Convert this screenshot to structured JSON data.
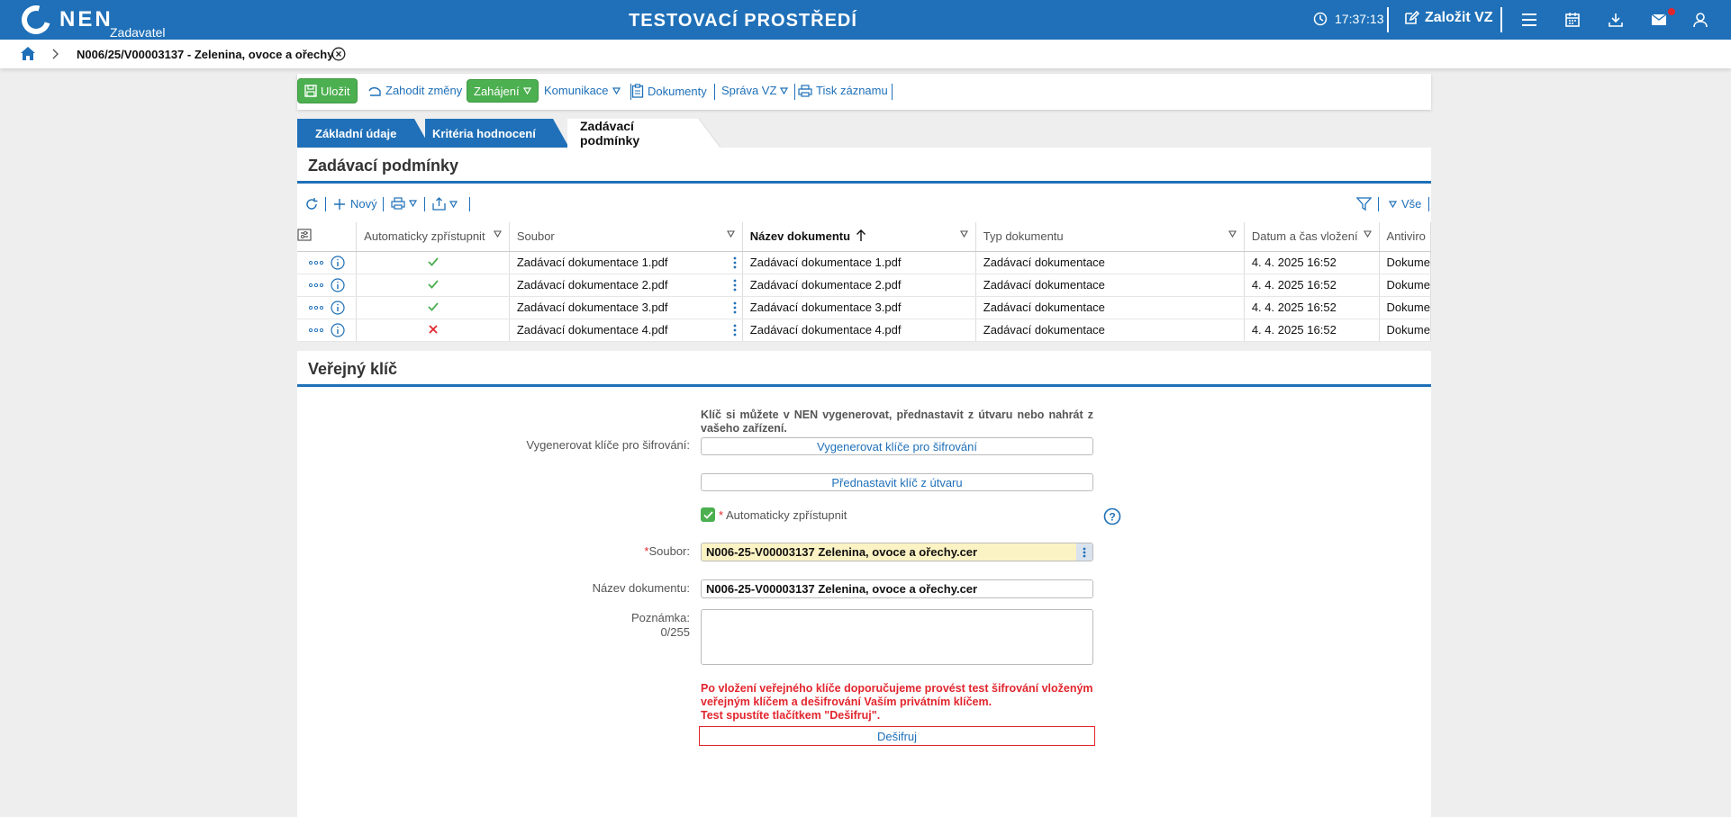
{
  "topbar": {
    "logo_text": "NEN",
    "logo_sub": "Zadavatel",
    "env_title": "TESTOVACÍ PROSTŘEDÍ",
    "clock": "17:37:13",
    "create_label": "Založit VZ",
    "icons": [
      "menu-icon",
      "calendar-icon",
      "download-icon",
      "mail-icon",
      "user-icon"
    ]
  },
  "breadcrumb": {
    "title": "N006/25/V00003137 - Zelenina, ovoce a ořechy"
  },
  "toolbar": {
    "save": "Uložit",
    "discard": "Zahodit změny",
    "start": "Zahájení",
    "communication": "Komunikace",
    "documents": "Dokumenty",
    "management": "Správa VZ",
    "print": "Tisk záznamu"
  },
  "tabs": [
    {
      "label": "Základní údaje"
    },
    {
      "label": "Kritéria hodnocení"
    },
    {
      "label": "Zadávací podmínky"
    }
  ],
  "conditions": {
    "heading": "Zadávací podmínky",
    "new_label": "Nový",
    "filter_all": "Vše",
    "columns": [
      "Automaticky zpřístupnit",
      "Soubor",
      "Název dokumentu",
      "Typ dokumentu",
      "Datum a čas vložení",
      "Antiviro"
    ],
    "rows": [
      {
        "auto": true,
        "file": "Zadávací dokumentace 1.pdf",
        "name": "Zadávací dokumentace 1.pdf",
        "type": "Zadávací dokumentace",
        "date": "4. 4. 2025 16:52",
        "antivirus": "Dokume"
      },
      {
        "auto": true,
        "file": "Zadávací dokumentace 2.pdf",
        "name": "Zadávací dokumentace 2.pdf",
        "type": "Zadávací dokumentace",
        "date": "4. 4. 2025 16:52",
        "antivirus": "Dokume"
      },
      {
        "auto": true,
        "file": "Zadávací dokumentace 3.pdf",
        "name": "Zadávací dokumentace 3.pdf",
        "type": "Zadávací dokumentace",
        "date": "4. 4. 2025 16:52",
        "antivirus": "Dokume"
      },
      {
        "auto": false,
        "file": "Zadávací dokumentace 4.pdf",
        "name": "Zadávací dokumentace 4.pdf",
        "type": "Zadávací dokumentace",
        "date": "4. 4. 2025 16:52",
        "antivirus": "Dokume"
      }
    ]
  },
  "public_key": {
    "heading": "Veřejný klíč",
    "info": "Klíč si můžete v NEN vygenerovat, přednastavit z útvaru nebo nahrát z vašeho zařízení.",
    "generate_label": "Vygenerovat klíče pro šifrování:",
    "generate_btn": "Vygenerovat klíče pro šifrování",
    "preset_btn": "Přednastavit klíč z útvaru",
    "auto_label": "Automaticky zpřístupnit",
    "auto_checked": true,
    "file_label": "Soubor:",
    "file_value": "N006-25-V00003137 Zelenina, ovoce a ořechy.cer",
    "docname_label": "Název dokumentu:",
    "docname_value": "N006-25-V00003137 Zelenina, ovoce a ořechy.cer",
    "note_label": "Poznámka:",
    "note_counter": "0/255",
    "note_value": "",
    "warning_1": "Po vložení veřejného klíče doporučujeme provést test šifrování vloženým",
    "warning_2": "veřejným klíčem a dešifrování Vaším privátním klíčem.",
    "warning_3": "Test spustíte tlačítkem \"Dešifruj\".",
    "decrypt_btn": "Dešifruj"
  },
  "colors": {
    "brand_blue": "#1f70b8",
    "green": "#4caf50",
    "error_red": "#e2262e",
    "required_yellow": "#fcf3c4"
  }
}
